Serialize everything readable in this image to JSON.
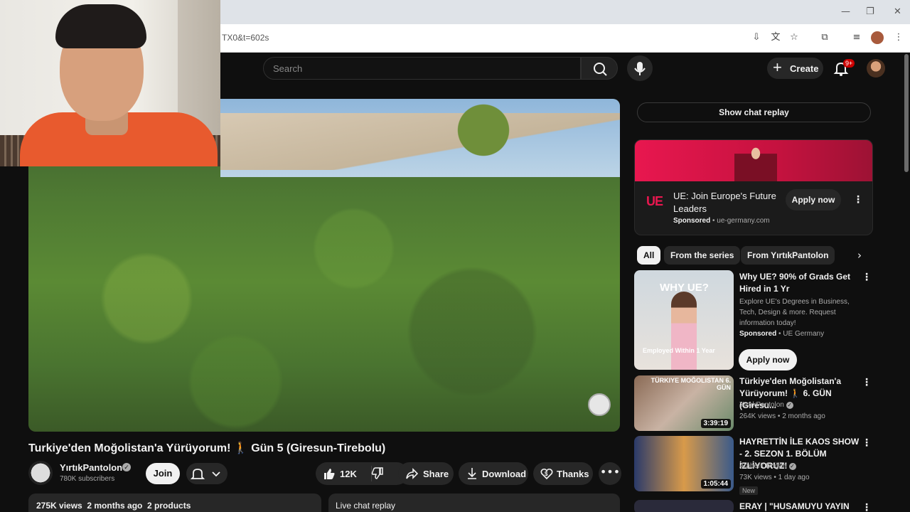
{
  "browser": {
    "url": "TX0&t=602s",
    "window_controls": [
      "—",
      "❐",
      "✕"
    ]
  },
  "header": {
    "search_placeholder": "Search",
    "create_label": "Create",
    "notifications_badge": "9+"
  },
  "video": {
    "title": "Turkiye'den Moğolistan'a Yürüyorum! 🚶 Gün 5 (Giresun-Tirebolu)"
  },
  "channel": {
    "name": "YırtıkPantolon",
    "subscribers": "780K subscribers",
    "join_label": "Join"
  },
  "actions": {
    "likes": "12K",
    "share": "Share",
    "download": "Download",
    "thanks": "Thanks"
  },
  "description": {
    "summary": "275K views  2 months ago  2 products"
  },
  "live_chat": {
    "replay_bar": "Live chat replay",
    "show_button": "Show chat replay"
  },
  "ad": {
    "logo": "UE",
    "title": "UE: Join Europe's Future Leaders",
    "sponsored": "Sponsored",
    "domain": "ue-germany.com",
    "cta": "Apply now"
  },
  "chips": [
    "All",
    "From the series",
    "From YırtıkPantolon"
  ],
  "recommendations": [
    {
      "title": "Why UE? 90% of Grads Get Hired in 1 Yr",
      "description": "Explore UE's Degrees in Business, Tech, Design & more. Request information today!",
      "sponsored": "Sponsored",
      "advertiser": "UE Germany",
      "cta": "Apply now",
      "thumb_text_top": "WHY UE?",
      "thumb_text_bottom": "Employed Within 1 Year"
    },
    {
      "title": "Türkiye'den Moğolistan'a Yürüyorum! 🚶 6. GÜN (Giresu...",
      "channel": "YırtıkPantolon",
      "meta": "264K views • 2 months ago",
      "duration": "3:39:19",
      "thumb_text": "TÜRKIYE MOĞOLISTAN 6. GÜN"
    },
    {
      "title": "HAYRETTİN İLE KAOS SHOW - 2. SEZON 1. BÖLÜM İZLİYORUZ!",
      "channel": "Ataberk Doğan",
      "meta": "73K views • 1 day ago",
      "duration": "1:05:44",
      "badge": "New"
    },
    {
      "title": "ERAY | \"HUSAMUYU YAYIN"
    }
  ],
  "colors": {
    "background": "#0f0f0f",
    "accent_red": "#cc0000",
    "ad_pink": "#e8174f"
  }
}
